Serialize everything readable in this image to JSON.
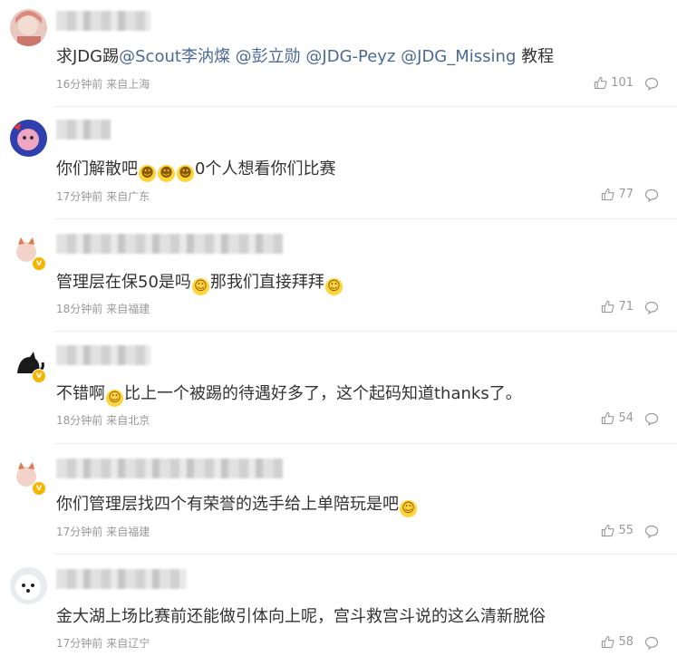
{
  "comments": [
    {
      "text_plain": "求JDG踢",
      "mentions": [
        "@Scout李汭燦",
        "@彭立勋",
        "@JDG-Peyz",
        "@JDG_Missing"
      ],
      "text_after": " 教程",
      "time": "16分钟前",
      "location": "来自上海",
      "likes": "101"
    },
    {
      "text_before": "你们解散吧",
      "emojis": [
        "😂",
        "😂",
        "😂"
      ],
      "text_after": "0个人想看你们比赛",
      "time": "17分钟前",
      "location": "来自广东",
      "likes": "77"
    },
    {
      "text_before": "管理层在保50是吗",
      "emoji1": "🤗",
      "text_mid": "那我们直接拜拜",
      "emoji2": "🤗",
      "time": "18分钟前",
      "location": "来自福建",
      "likes": "71"
    },
    {
      "text_before": "不错啊",
      "emoji1": "😏",
      "text_after": "比上一个被踢的待遇好多了，这个起码知道thanks了。",
      "time": "18分钟前",
      "location": "来自北京",
      "likes": "54"
    },
    {
      "text_before": "你们管理层找四个有荣誉的选手给上单陪玩是吧",
      "emoji1": "🤗",
      "time": "17分钟前",
      "location": "来自福建",
      "likes": "55"
    },
    {
      "text": "金大湖上场比赛前还能做引体向上呢，宫斗救宫斗说的这么清新脱俗",
      "time": "17分钟前",
      "location": "来自辽宁",
      "likes": "58"
    }
  ]
}
